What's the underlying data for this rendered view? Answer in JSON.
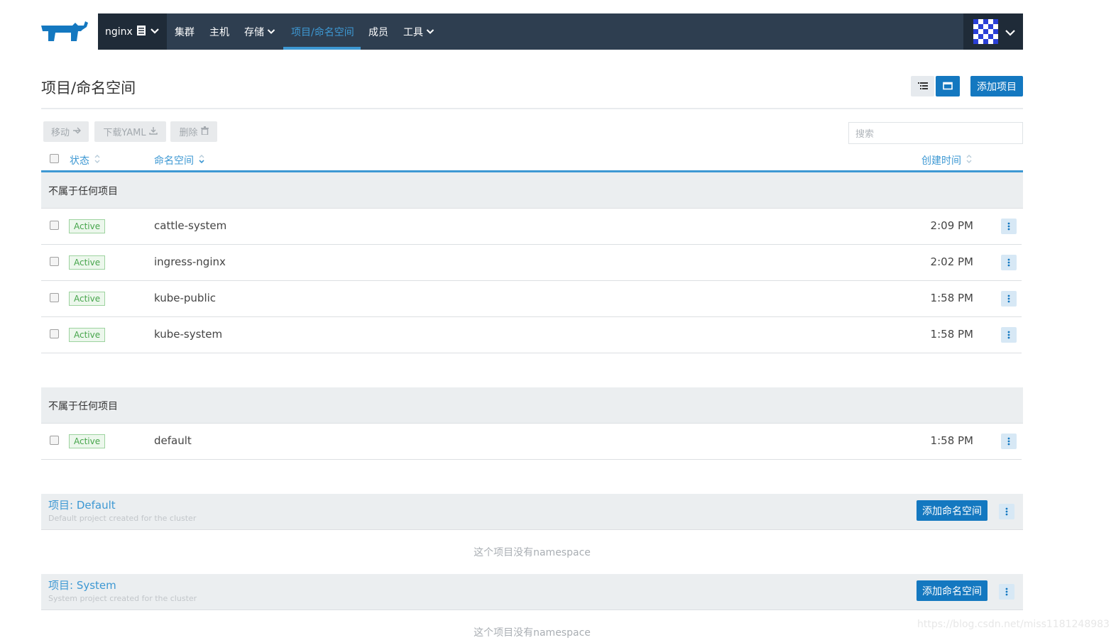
{
  "nav": {
    "cluster_name": "nginx",
    "items": [
      {
        "label": "集群"
      },
      {
        "label": "主机"
      },
      {
        "label": "存储"
      },
      {
        "label": "项目/命名空间"
      },
      {
        "label": "成员"
      },
      {
        "label": "工具"
      }
    ],
    "active_item": "项目/命名空间"
  },
  "page": {
    "title": "项目/命名空间",
    "add_project_label": "添加项目"
  },
  "bulk_actions": {
    "move_label": "移动",
    "download_yaml_label": "下载YAML",
    "delete_label": "删除"
  },
  "search": {
    "placeholder": "搜索"
  },
  "table": {
    "columns": {
      "state": "状态",
      "namespace": "命名空间",
      "created": "创建时间"
    }
  },
  "groups": [
    {
      "label": "不属于任何项目",
      "rows": [
        {
          "state": "Active",
          "name": "cattle-system",
          "time": "2:09 PM"
        },
        {
          "state": "Active",
          "name": "ingress-nginx",
          "time": "2:02 PM"
        },
        {
          "state": "Active",
          "name": "kube-public",
          "time": "1:58 PM"
        },
        {
          "state": "Active",
          "name": "kube-system",
          "time": "1:58 PM"
        }
      ]
    },
    {
      "label": "不属于任何项目",
      "rows": [
        {
          "state": "Active",
          "name": "default",
          "time": "1:58 PM"
        }
      ]
    }
  ],
  "projects": [
    {
      "title": "项目: Default",
      "description": "Default project created for the cluster",
      "add_ns_label": "添加命名空间",
      "empty_message": "这个项目没有namespace"
    },
    {
      "title": "项目: System",
      "description": "System project created for the cluster",
      "add_ns_label": "添加命名空间",
      "empty_message": "这个项目没有namespace"
    }
  ],
  "watermark": "https://blog.csdn.net/miss1181248983",
  "colors": {
    "nav_bg": "#2e3e50",
    "accent": "#3d98d3",
    "primary_button": "#1478c0",
    "active_badge": "#46a54b"
  }
}
